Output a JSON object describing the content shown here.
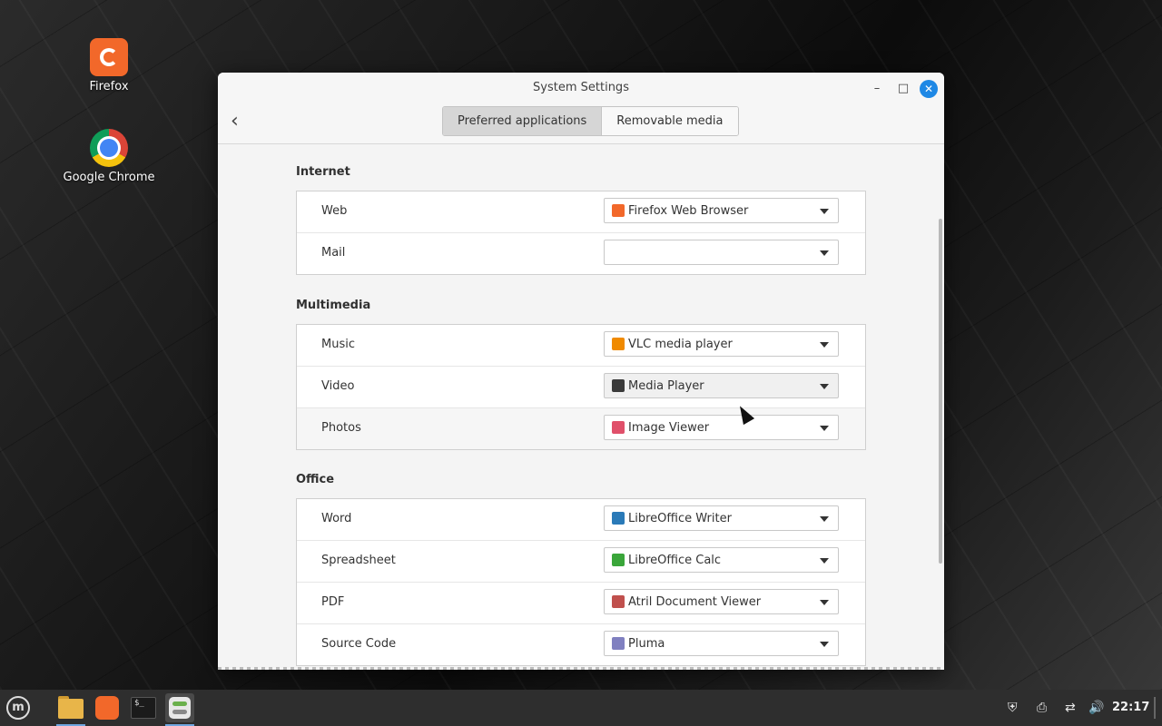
{
  "desktop": {
    "icons": [
      {
        "label": "Firefox",
        "icon": "firefox-icon"
      },
      {
        "label": "Google Chrome",
        "icon": "chrome-icon"
      }
    ]
  },
  "window": {
    "title": "System Settings",
    "controls": {
      "minimize": "–",
      "maximize": "□",
      "close": "✕"
    },
    "back_glyph": "‹",
    "tabs": [
      {
        "label": "Preferred applications",
        "active": true
      },
      {
        "label": "Removable media",
        "active": false
      }
    ]
  },
  "sections": [
    {
      "title": "Internet",
      "rows": [
        {
          "label": "Web",
          "value": "Firefox Web Browser",
          "icon": "firefox-icon",
          "icon_color": "#f2682a"
        },
        {
          "label": "Mail",
          "value": "",
          "icon": "",
          "icon_color": ""
        }
      ]
    },
    {
      "title": "Multimedia",
      "rows": [
        {
          "label": "Music",
          "value": "VLC media player",
          "icon": "vlc-icon",
          "icon_color": "#f08a00"
        },
        {
          "label": "Video",
          "value": "Media Player",
          "icon": "media-player-icon",
          "icon_color": "#3a3a3a"
        },
        {
          "label": "Photos",
          "value": "Image Viewer",
          "icon": "image-viewer-icon",
          "icon_color": "#e0506a"
        }
      ]
    },
    {
      "title": "Office",
      "rows": [
        {
          "label": "Word",
          "value": "LibreOffice Writer",
          "icon": "writer-icon",
          "icon_color": "#2a7ab8"
        },
        {
          "label": "Spreadsheet",
          "value": "LibreOffice Calc",
          "icon": "calc-icon",
          "icon_color": "#3aa63a"
        },
        {
          "label": "PDF",
          "value": "Atril Document Viewer",
          "icon": "atril-icon",
          "icon_color": "#c0504d"
        },
        {
          "label": "Source Code",
          "value": "Pluma",
          "icon": "pluma-icon",
          "icon_color": "#8080c0"
        }
      ]
    }
  ],
  "taskbar": {
    "menu_glyph": "m",
    "terminal_glyph": "$_",
    "tray": {
      "shield": "⛨",
      "printer": "⎙",
      "network": "⇄",
      "volume": "🔊"
    },
    "clock": "22:17"
  }
}
